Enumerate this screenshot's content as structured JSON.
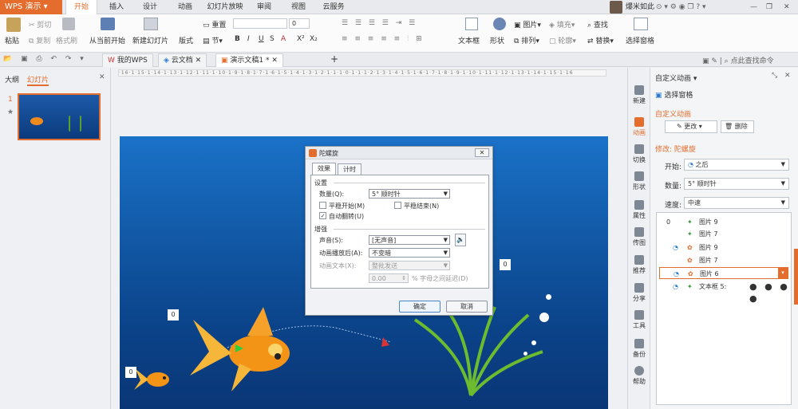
{
  "app": {
    "name": "WPS 演示",
    "account": "爆米如此"
  },
  "menu": {
    "tabs": [
      "开始",
      "插入",
      "设计",
      "动画",
      "幻灯片放映",
      "审阅",
      "视图",
      "云服务"
    ],
    "active": 0
  },
  "ribbon": {
    "paste": "粘贴",
    "cut": "剪切",
    "copy": "复制",
    "format_painter": "格式刷",
    "from_current": "从当前开始",
    "new_slide": "新建幻灯片",
    "layout": "版式",
    "section": "节",
    "reset": "重置",
    "font_size": "0",
    "bold": "B",
    "italic": "I",
    "underline": "U",
    "shadow": "S",
    "font_color": "A",
    "superscript": "X²",
    "subscript": "X₂",
    "textbox": "文本框",
    "shape": "形状",
    "picture": "图片",
    "arrange": "排列",
    "fill": "填充",
    "outline": "轮廓",
    "find": "查找",
    "replace": "替换",
    "select_pane": "选择窗格"
  },
  "quick": {
    "find_cmd": "点此查找命令"
  },
  "doctabs": {
    "tabs": [
      "我的WPS",
      "云文档",
      "演示文稿1 *"
    ],
    "active": 2,
    "new_tab": "+"
  },
  "left": {
    "tabs": [
      "大纲",
      "幻灯片"
    ],
    "active": 1,
    "slide_number": "1",
    "star": "★"
  },
  "ruler": {
    "text": "·16·1·15·1·14·1·13·1·12·1·11·1·10·1·9·1·8·1·7·1·6·1·5·1·4·1·3·1·2·1·1·1·0·1·1·1·2·1·3·1·4·1·5·1·6·1·7·1·8·1·9·1·10·1·11·1·12·1·13·1·14·1·15·1·16"
  },
  "slide": {
    "badges": [
      "0",
      "0",
      "0"
    ]
  },
  "dialog": {
    "title": "陀螺旋",
    "tabs": [
      "效果",
      "计时"
    ],
    "active_tab": 0,
    "section_settings": "设置",
    "amount_label": "数量(Q):",
    "amount_value": "5° 顺时针",
    "smooth_start": "平稳开始(M)",
    "smooth_end": "平稳结束(N)",
    "auto_reverse": "自动翻转(U)",
    "auto_reverse_checked": true,
    "section_enhance": "增强",
    "sound_label": "声音(S):",
    "sound_value": "[无声音]",
    "after_label": "动画播放后(A):",
    "after_value": "不变暗",
    "text_label": "动画文本(X):",
    "text_value": "整批发送",
    "delay_value": "0.00",
    "delay_suffix": "% 字母之间延迟(D)",
    "ok": "确定",
    "cancel": "取消"
  },
  "sidebar": {
    "items": [
      "新建",
      "动画",
      "切换",
      "形状",
      "属性",
      "传图",
      "推荐",
      "分享",
      "工具",
      "备份",
      "帮助"
    ]
  },
  "pane": {
    "title": "自定义动画",
    "select_pane": "选择窗格",
    "section": "自定义动画",
    "change": "更改",
    "delete": "删除",
    "modify": "修改: 陀螺旋",
    "start_label": "开始:",
    "start_value": "之后",
    "amount_label": "数量:",
    "amount_value": "5° 顺时针",
    "speed_label": "速度:",
    "speed_value": "中速",
    "items": [
      {
        "index": "0",
        "name": "图片 9"
      },
      {
        "index": "",
        "name": "图片 7"
      },
      {
        "index": "",
        "name": "图片 9"
      },
      {
        "index": "",
        "name": "图片 7"
      },
      {
        "index": "",
        "name": "图片 6"
      },
      {
        "index": "",
        "name": "文本框 5:"
      }
    ],
    "selected": 4
  },
  "colors": {
    "accent": "#e46c2c",
    "slide_bg": "#125aa8",
    "selected_border": "#e46c2c"
  }
}
